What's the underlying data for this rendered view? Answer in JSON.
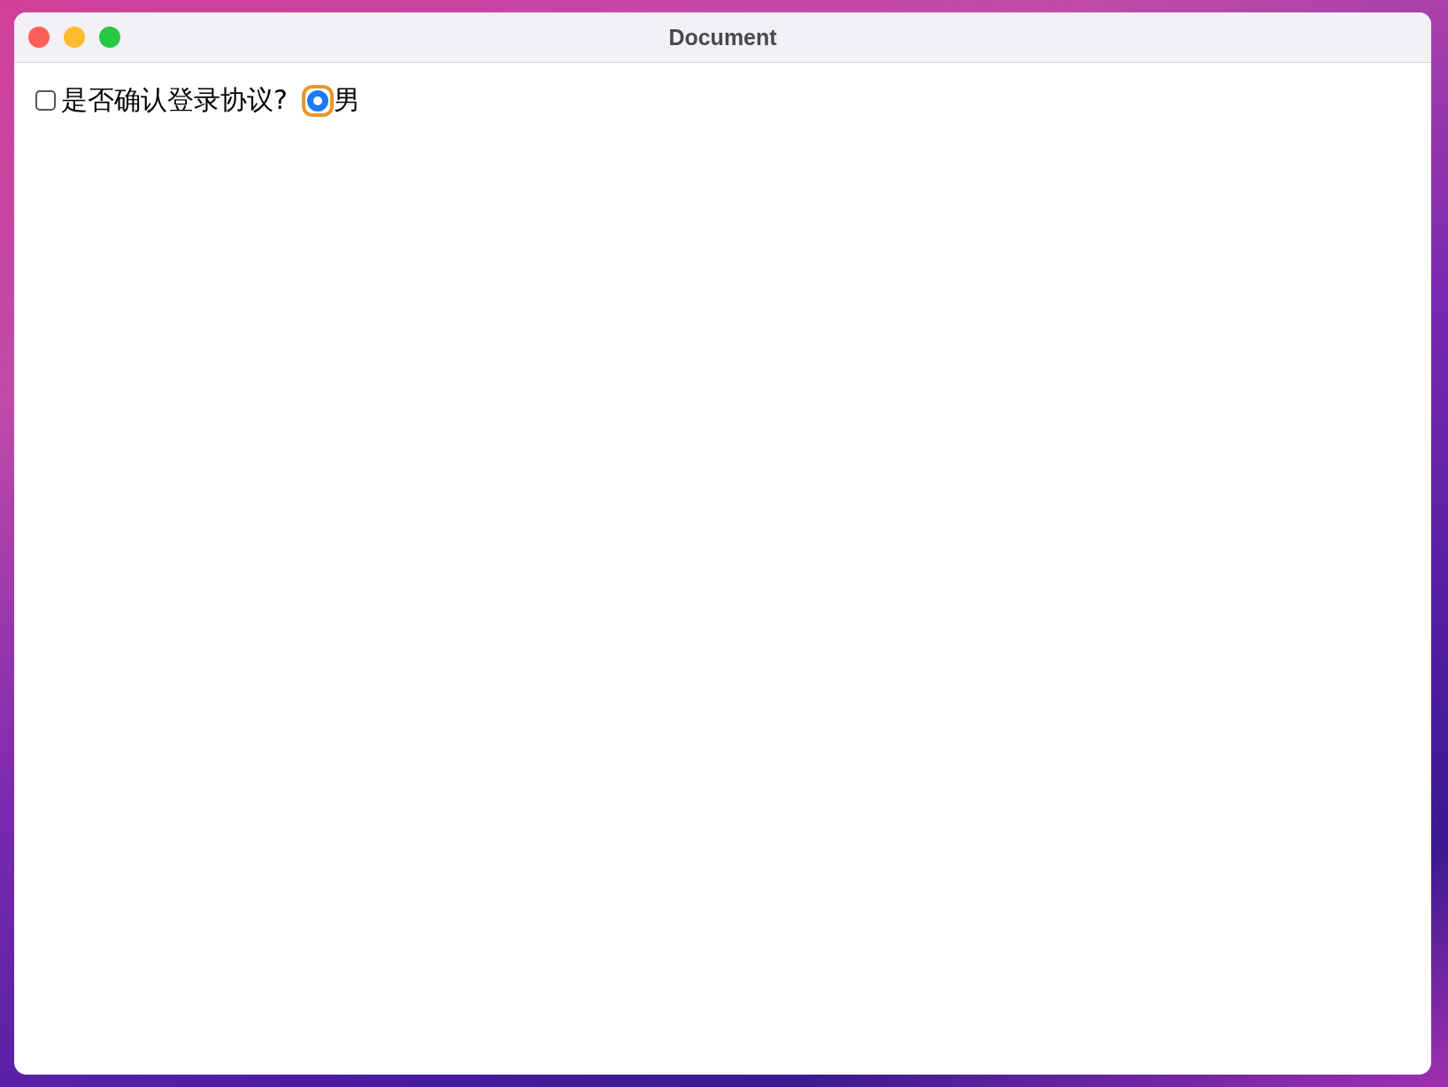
{
  "window": {
    "title": "Document"
  },
  "checkbox": {
    "label": "是否确认登录协议?",
    "checked": false
  },
  "radio": {
    "label": "男",
    "selected": true,
    "focused": true
  }
}
